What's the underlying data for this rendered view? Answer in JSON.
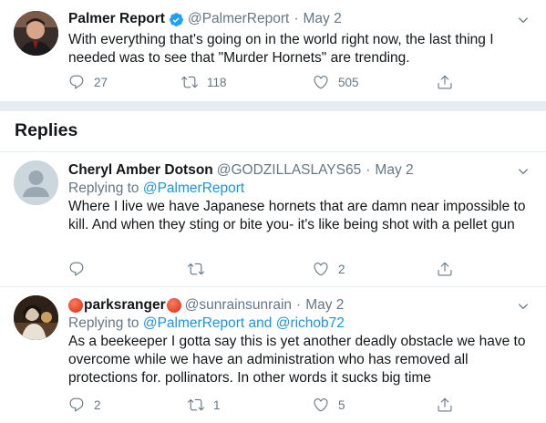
{
  "main_tweet": {
    "name": "Palmer Report",
    "handle": "@PalmerReport",
    "date": "May 2",
    "text": "With everything that's going on in the world right now, the last thing I needed was to see that \"Murder Hornets\" are trending.",
    "replies": "27",
    "retweets": "118",
    "likes": "505"
  },
  "replies_section": {
    "title": "Replies"
  },
  "reply1": {
    "name": "Cheryl Amber Dotson",
    "handle": "@GODZILLASLAYS65",
    "date": "May 2",
    "replying_prefix": "Replying to",
    "replying_to": "@PalmerReport",
    "text": "Where I live we have Japanese hornets that are damn near impossible to kill. And when they sting or bite you- it's like being shot with a pellet gun",
    "likes": "2"
  },
  "reply2": {
    "name": "parksranger",
    "handle": "@sunrainsunrain",
    "date": "May 2",
    "replying_prefix": "Replying to",
    "replying_to_1": "@PalmerReport",
    "replying_and": "and",
    "replying_to_2": "@richob72",
    "text": "As a beekeeper I gotta say this is yet another deadly obstacle we have to overcome while we have an administration who has removed all protections for. pollinators. In other words it sucks big time",
    "replies": "2",
    "retweets": "1",
    "likes": "5"
  },
  "colors": {
    "text": "#14171a",
    "secondary": "#657786",
    "link": "#1b95e0",
    "divider": "#e6ecf0"
  },
  "icons": [
    "verified-icon",
    "caret-down-icon",
    "reply-icon",
    "retweet-icon",
    "like-icon",
    "share-icon",
    "apple-emoji"
  ]
}
